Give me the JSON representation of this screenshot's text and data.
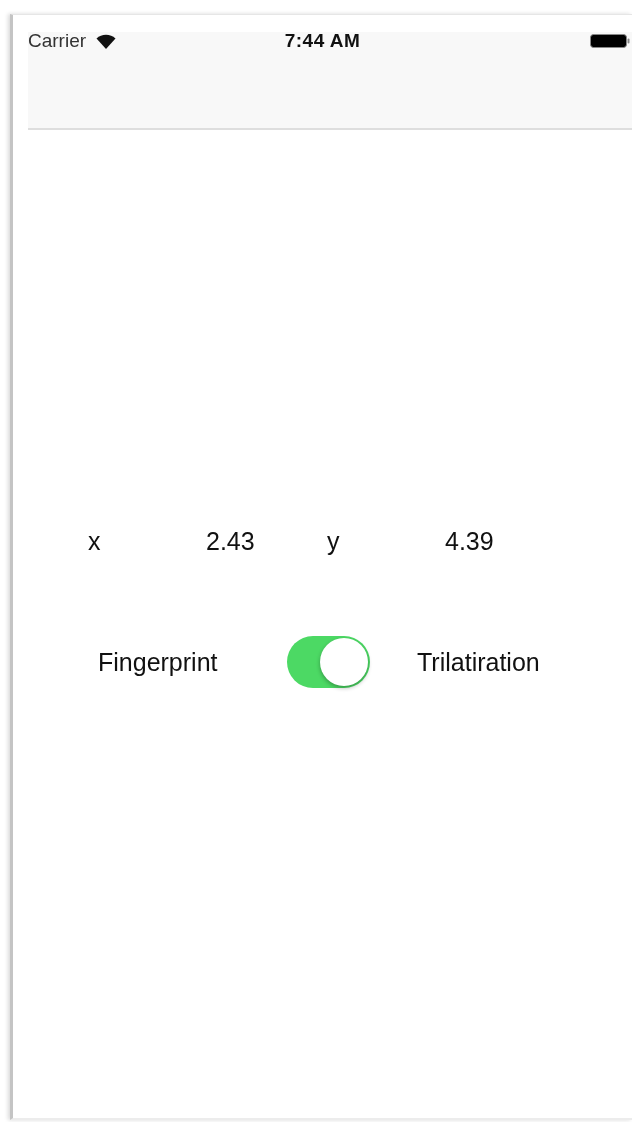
{
  "status_bar": {
    "carrier": "Carrier",
    "time": "7:44 AM"
  },
  "coordinates": [
    {
      "label": "x",
      "value": "2.43"
    },
    {
      "label": "y",
      "value": "4.39"
    }
  ],
  "mode_switch": {
    "left_label": "Fingerprint",
    "right_label": "Trilatiration",
    "on": true
  }
}
